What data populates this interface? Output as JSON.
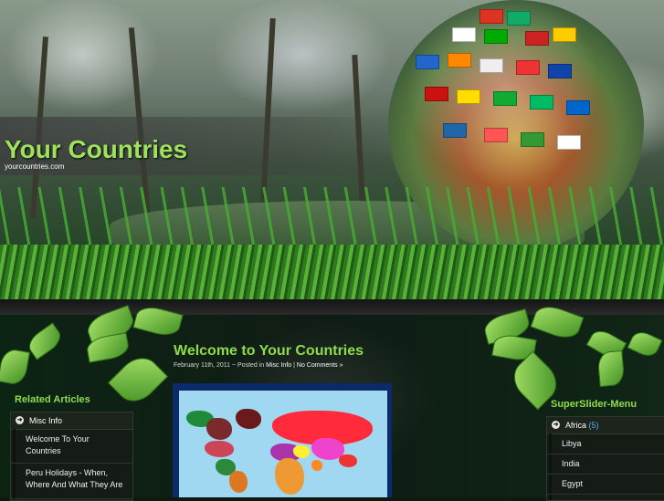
{
  "site": {
    "title": "Your Countries",
    "url": "yourcountries.com"
  },
  "post": {
    "title": "Welcome to Your Countries",
    "date": "February 11th, 2011",
    "separator1": "~",
    "posted_in_label": "Posted in",
    "category": "Misc Info",
    "separator2": "|",
    "comments": "No Comments »"
  },
  "left_sidebar": {
    "title": "Related Articles",
    "category": "Misc Info",
    "items": [
      "Welcome To Your Countries",
      "Peru Holidays - When, Where And What They Are"
    ]
  },
  "right_sidebar": {
    "title": "SuperSlider-Menu",
    "category": "Africa",
    "count": "(5)",
    "items": [
      "Libya",
      "India",
      "Egypt"
    ]
  },
  "colors": {
    "title_green": "#9fe05c",
    "accent_green": "#8fdc4a",
    "count_blue": "#5fb0e8"
  }
}
